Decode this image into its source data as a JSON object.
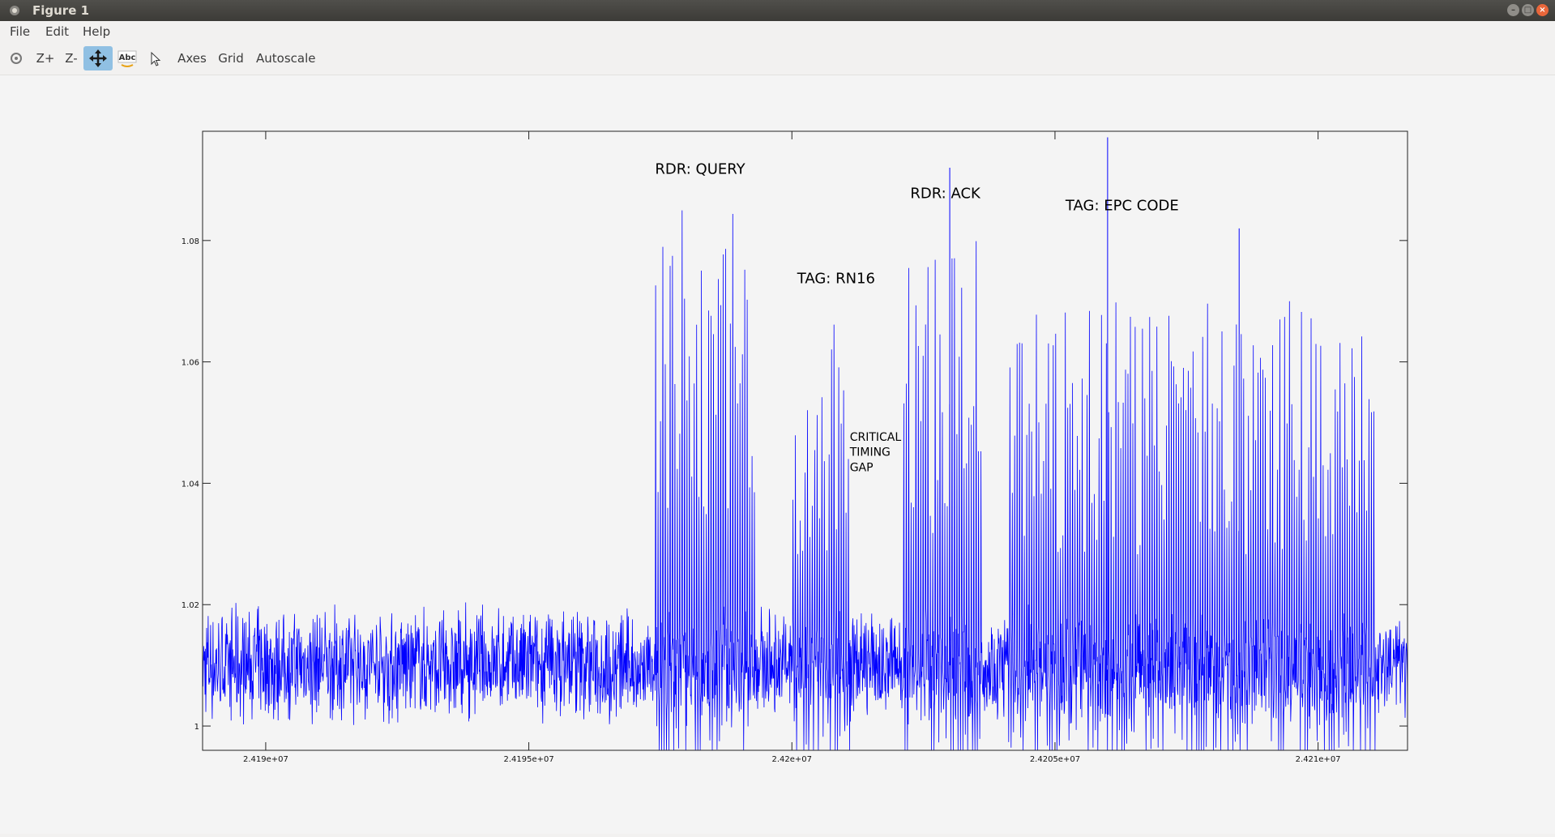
{
  "window": {
    "title": "Figure 1"
  },
  "menu": {
    "file": "File",
    "edit": "Edit",
    "help": "Help"
  },
  "toolbar": {
    "zoom_in": "Z+",
    "zoom_out": "Z-",
    "text_tool": "Abc",
    "axes": "Axes",
    "grid": "Grid",
    "autoscale": "Autoscale"
  },
  "colors": {
    "signal": "#0000ff",
    "pan_active": "#90c0e3",
    "titlebar": "#3c3b37"
  },
  "chart_data": {
    "type": "line",
    "title": "",
    "xlabel": "",
    "ylabel": "",
    "xlim": [
      24188800,
      24211700
    ],
    "ylim": [
      0.996,
      1.098
    ],
    "xticks": [
      24190000,
      24195000,
      24200000,
      24205000,
      24210000
    ],
    "xtick_labels": [
      "2.419e+07",
      "2.4195e+07",
      "2.42e+07",
      "2.4205e+07",
      "2.421e+07"
    ],
    "yticks": [
      1.0,
      1.02,
      1.04,
      1.06,
      1.08
    ],
    "ytick_labels": [
      "1",
      "1.02",
      "1.04",
      "1.06",
      "1.08"
    ],
    "grid": false,
    "series": [
      {
        "color": "#0000ff",
        "baseline": 1.01,
        "noise_amplitude": 0.007,
        "bursts": [
          {
            "x": [
              24197400,
              24198400
            ],
            "peak": 1.09
          },
          {
            "x": [
              24198400,
              24199300
            ],
            "peak": 1.088
          },
          {
            "x": [
              24200000,
              24201100
            ],
            "peak": 1.067
          },
          {
            "x": [
              24202100,
              24203600
            ],
            "peak": 1.08
          },
          {
            "x": [
              24204100,
              24211100
            ],
            "peak": 1.07
          }
        ],
        "spikes": [
          {
            "x": 24206000,
            "y": 1.097
          },
          {
            "x": 24203000,
            "y": 1.092
          },
          {
            "x": 24208500,
            "y": 1.082
          }
        ]
      }
    ],
    "annotations": [
      {
        "text": "RDR: QUERY",
        "x": 24197400,
        "y": 1.091
      },
      {
        "text": "TAG: RN16",
        "x": 24200100,
        "y": 1.073
      },
      {
        "text": "CRITICAL",
        "x": 24201100,
        "y": 1.047
      },
      {
        "text": "TIMING",
        "x": 24201100,
        "y": 1.0445
      },
      {
        "text": "GAP",
        "x": 24201100,
        "y": 1.042
      },
      {
        "text": "RDR: ACK",
        "x": 24202250,
        "y": 1.087
      },
      {
        "text": "TAG: EPC CODE",
        "x": 24205200,
        "y": 1.085
      }
    ]
  }
}
